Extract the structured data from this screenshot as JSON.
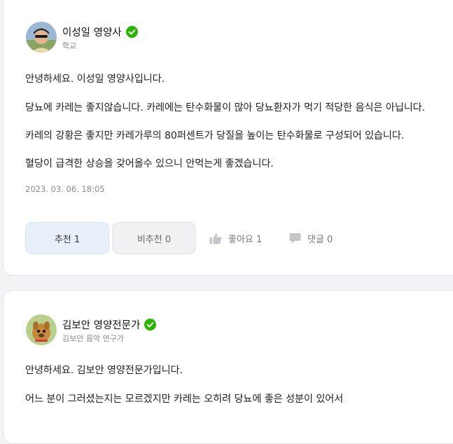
{
  "answers": [
    {
      "author_name": "이성일 영양사",
      "author_sub": "학교",
      "paragraphs": [
        "안녕하세요. 이성일 영양사입니다.",
        "당뇨에 카레는 좋지않습니다. 카레에는 탄수화물이 많아 당뇨환자가 먹기 적당한 음식은 아닙니다.",
        "카레의 강황은 좋지만 카레가루의 80퍼센트가 당질을 높이는 탄수화물로 구성되어 있습니다.",
        "혈당이 급격한 상승을 갖어올수 있으니 안먹는게 좋겠습니다."
      ],
      "date": "2023. 03. 06. 18:05",
      "recommend_label": "추천 1",
      "not_recommend_label": "비추천 0",
      "like_label": "좋아요 1",
      "comment_label": "댓글 0"
    },
    {
      "author_name": "김보안 영양전문가",
      "author_sub": "김보안 음악 연구가",
      "paragraphs": [
        "안녕하세요. 김보안 영양전문가입니다.",
        "어느 분이 그러셨는지는 모르겠지만 카레는 오히려 당뇨에 좋은 성분이 있어서"
      ]
    }
  ],
  "icons": {
    "verified": "check-badge-icon",
    "like": "thumbs-up-icon",
    "comment": "speech-bubble-icon"
  },
  "colors": {
    "verified_green": "#2db400",
    "recommend_bg": "#e8eff8",
    "not_recommend_bg": "#f1f1f4"
  }
}
